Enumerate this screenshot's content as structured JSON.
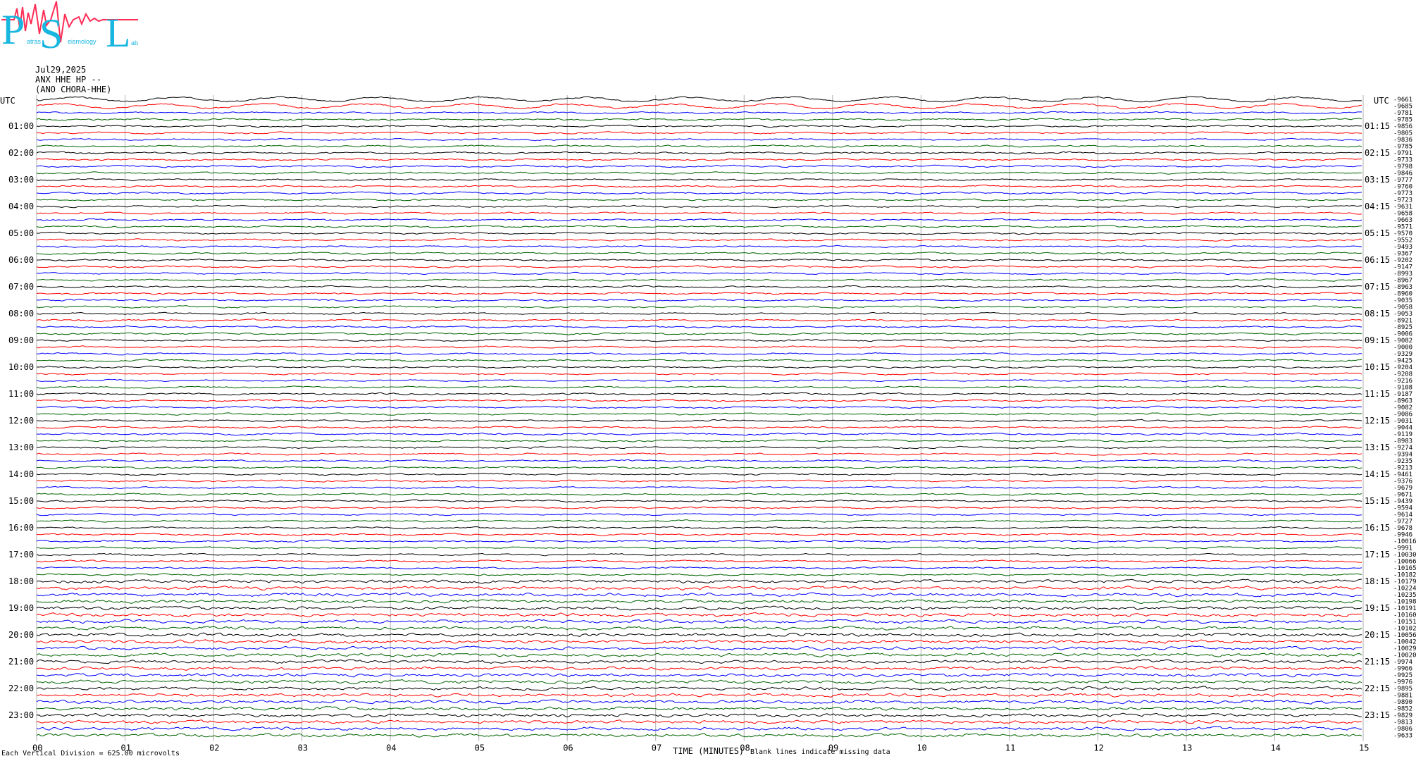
{
  "logo": {
    "letters": [
      "P",
      "S",
      "L"
    ],
    "subtext": [
      "atras",
      "eismology",
      "ab"
    ],
    "colors": {
      "letters": "#19b7e0",
      "wave": "#ff2d55"
    }
  },
  "header": {
    "date": "Jul29,2025",
    "channel": "ANX HHE HP --",
    "station": "(ANO CHORA-HHE)"
  },
  "utc_label": "UTC",
  "footer": {
    "scale_text": "Each Vertical Division = 625.00 microvolts",
    "axis_title": "TIME (MINUTES)",
    "note": "Blank lines indicate missing data"
  },
  "colors": [
    "#000000",
    "#ff0000",
    "#0000ff",
    "#006400"
  ],
  "chart_data": {
    "type": "helicorder",
    "traces_per_hour": 4,
    "minutes_per_trace": 15,
    "x_ticks": [
      "00",
      "01",
      "02",
      "03",
      "04",
      "05",
      "06",
      "07",
      "08",
      "09",
      "10",
      "11",
      "12",
      "13",
      "14",
      "15"
    ],
    "left_hour_labels": [
      "01:00",
      "02:00",
      "03:00",
      "04:00",
      "05:00",
      "06:00",
      "07:00",
      "08:00",
      "09:00",
      "10:00",
      "11:00",
      "12:00",
      "13:00",
      "14:00",
      "15:00",
      "16:00",
      "17:00",
      "18:00",
      "19:00",
      "20:00",
      "21:00",
      "22:00",
      "23:00"
    ],
    "right_hour_labels": [
      "01:15",
      "02:15",
      "03:15",
      "04:15",
      "05:15",
      "06:15",
      "07:15",
      "08:15",
      "09:15",
      "10:15",
      "11:15",
      "12:15",
      "13:15",
      "14:15",
      "15:15",
      "16:15",
      "17:15",
      "18:15",
      "19:15",
      "20:15",
      "21:15",
      "22:15",
      "23:15"
    ],
    "trace_offsets": [
      "-9661",
      "-9685",
      "-9781",
      "-9785",
      "-9856",
      "-9805",
      "-9836",
      "-9785",
      "-9791",
      "-9733",
      "-9798",
      "-9846",
      "-9777",
      "-9760",
      "-9773",
      "-9723",
      "-9631",
      "-9658",
      "-9663",
      "-9571",
      "-9570",
      "-9552",
      "-9493",
      "-9367",
      "-9202",
      "-9147",
      "-8993",
      "-8967",
      "-8963",
      "-8960",
      "-9035",
      "-9058",
      "-9053",
      "-8921",
      "-8925",
      "-9006",
      "-9082",
      "-9000",
      "-9329",
      "-9425",
      "-9204",
      "-9208",
      "-9216",
      "-9108",
      "-9187",
      "-8963",
      "-9082",
      "-9086",
      "-9031",
      "-9044",
      "-9119",
      "-8983",
      "-9274",
      "-9394",
      "-9235",
      "-9213",
      "-9461",
      "-9376",
      "-9679",
      "-9671",
      "-9439",
      "-9594",
      "-9614",
      "-9727",
      "-9678",
      "-9946",
      "-10016",
      "-9991",
      "-10030",
      "-10066",
      "-10165",
      "-10182",
      "-10179",
      "-10224",
      "-10235",
      "-10198",
      "-10191",
      "-10160",
      "-10151",
      "-10102",
      "-10056",
      "-10042",
      "-10029",
      "-10020",
      "-9974",
      "-9966",
      "-9925",
      "-9976",
      "-9895",
      "-9881",
      "-9890",
      "-9852",
      "-9829",
      "-9813",
      "-9806",
      "-9633"
    ]
  }
}
